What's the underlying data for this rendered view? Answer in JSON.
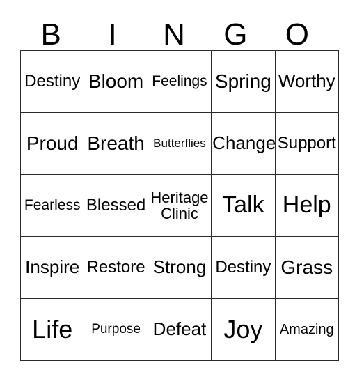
{
  "card": {
    "header_letters": [
      "B",
      "I",
      "N",
      "G",
      "O"
    ],
    "rows": [
      [
        {
          "text": "Destiny",
          "size": "fs-lg"
        },
        {
          "text": "Bloom",
          "size": "fs-xl"
        },
        {
          "text": "Feelings",
          "size": "fs-md"
        },
        {
          "text": "Spring",
          "size": "fs-xl"
        },
        {
          "text": "Worthy",
          "size": "fs-lgp"
        }
      ],
      [
        {
          "text": "Proud",
          "size": "fs-xl"
        },
        {
          "text": "Breath",
          "size": "fs-xl"
        },
        {
          "text": "Butterflies",
          "size": "fs-xs"
        },
        {
          "text": "Change",
          "size": "fs-lgp"
        },
        {
          "text": "Support",
          "size": "fs-lg"
        }
      ],
      [
        {
          "text": "Fearless",
          "size": "fs-md"
        },
        {
          "text": "Blessed",
          "size": "fs-lg"
        },
        {
          "text": "Heritage\nClinic",
          "size": "fs-mdp"
        },
        {
          "text": "Talk",
          "size": "fs-xxl"
        },
        {
          "text": "Help",
          "size": "fs-xxl"
        }
      ],
      [
        {
          "text": "Inspire",
          "size": "fs-lgp"
        },
        {
          "text": "Restore",
          "size": "fs-lg"
        },
        {
          "text": "Strong",
          "size": "fs-lgp"
        },
        {
          "text": "Destiny",
          "size": "fs-lg"
        },
        {
          "text": "Grass",
          "size": "fs-xl"
        }
      ],
      [
        {
          "text": "Life",
          "size": "fs-huge"
        },
        {
          "text": "Purpose",
          "size": "fs-sm"
        },
        {
          "text": "Defeat",
          "size": "fs-lgp"
        },
        {
          "text": "Joy",
          "size": "fs-huge"
        },
        {
          "text": "Amazing",
          "size": "fs-smp"
        }
      ]
    ]
  },
  "colors": {
    "background": "#ffffff",
    "border": "#2b2b2b",
    "text": "#000000"
  }
}
